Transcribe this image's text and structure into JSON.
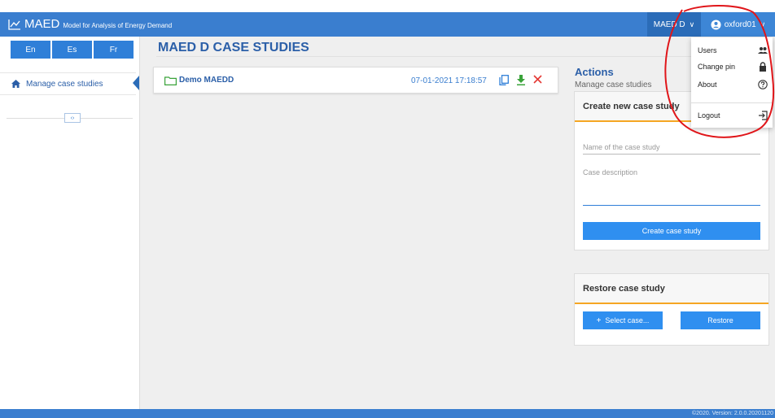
{
  "header": {
    "app_name": "MAED",
    "tagline": "Model for Analysis of Energy Demand",
    "case_menu_label": "MAED D",
    "user_menu_label": "oxford01"
  },
  "sidebar": {
    "languages": [
      "En",
      "Es",
      "Fr"
    ],
    "active_item": "Manage case studies"
  },
  "main": {
    "page_title": "MAED D CASE STUDIES",
    "case_studies": [
      {
        "name": "Demo MAEDD",
        "date": "07-01-2021 17:18:57"
      }
    ],
    "actions": {
      "title": "Actions",
      "subtitle": "Manage case studies"
    },
    "create_panel": {
      "title": "Create new case study",
      "name_placeholder": "Name of the case study",
      "description_placeholder": "Case description",
      "create_button": "Create case study"
    },
    "restore_panel": {
      "title": "Restore case study",
      "select_button": "Select case...",
      "restore_button": "Restore"
    }
  },
  "user_dropdown": {
    "items": [
      "Users",
      "Change pin",
      "About"
    ],
    "logout": "Logout"
  },
  "footer": {
    "text": "©2020. Version: 2.0.0.20201120"
  },
  "colors": {
    "primary": "#3a7ecf",
    "accent": "#f5a623",
    "annotation": "#e0161a",
    "delete": "#e53935",
    "download": "#3aa33a"
  },
  "icons": {
    "brand": "line-chart-icon",
    "home": "home-icon",
    "folder": "folder-icon",
    "copy": "copy-icon",
    "download": "download-icon",
    "delete": "close-icon",
    "users": "users-icon",
    "change_pin": "lock-icon",
    "about": "help-circle-icon",
    "logout": "logout-icon"
  }
}
